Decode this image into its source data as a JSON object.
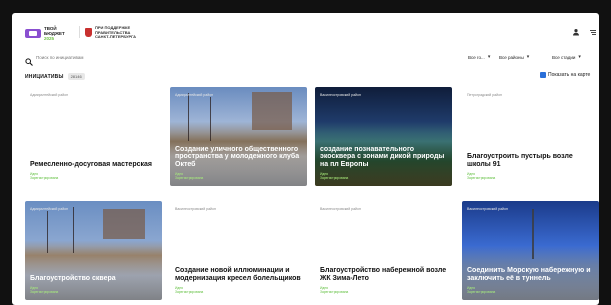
{
  "header": {
    "logo_line1": "ТВОЙ",
    "logo_line2": "БЮДЖЕТ",
    "logo_line3": "2025",
    "gov_line1": "ПРИ ПОДДЕРЖКЕ",
    "gov_line2": "ПРАВИТЕЛЬСТВА",
    "gov_line3": "САНКТ-ПЕТЕРБУРГА",
    "user_icon": "user-icon",
    "menu_icon": "menu-icon"
  },
  "search": {
    "placeholder": "Поиск по инициативам"
  },
  "filters": {
    "years": "Все го...",
    "districts": "Все районы",
    "stages": "Все стадии"
  },
  "section": {
    "title": "ИНИЦИАТИВЫ",
    "count": "28146",
    "map_link": "Показать на карте"
  },
  "cards": [
    {
      "district": "Адмиралтейский район",
      "title": "Ремесленно-досуговая мастерская",
      "meta1": "Идея",
      "meta2": "Зарегистрирована"
    },
    {
      "district": "Адмиралтейский район",
      "title": "Создание уличного общественного пространства у молодежного клуба Октеб",
      "meta1": "Идея",
      "meta2": "Зарегистрирована"
    },
    {
      "district": "Василеостровский район",
      "title": "создание познавательного экоскверa с зонами дикой природы на пл Европы",
      "meta1": "Идея",
      "meta2": "Зарегистрирована"
    },
    {
      "district": "Петроградский район",
      "title": "Благоустроить пустырь возле школы 91",
      "meta1": "Идея",
      "meta2": "Зарегистрирована"
    },
    {
      "district": "Адмиралтейский район",
      "title": "Благоустройство сквера",
      "meta1": "Идея",
      "meta2": "Зарегистрирована"
    },
    {
      "district": "Василеостровский район",
      "title": "Создание новой иллюминации и модернизация кресел болельщиков",
      "meta1": "Идея",
      "meta2": "Зарегистрирована"
    },
    {
      "district": "Василеостровский район",
      "title": "Благоустройство набережной возле ЖК Зима-Лето",
      "meta1": "Идея",
      "meta2": "Зарегистрирована"
    },
    {
      "district": "Василеостровский район",
      "title": "Соединить Морскую набережную и заключить её в туннель",
      "meta1": "Идея",
      "meta2": "Зарегистрирована"
    }
  ]
}
